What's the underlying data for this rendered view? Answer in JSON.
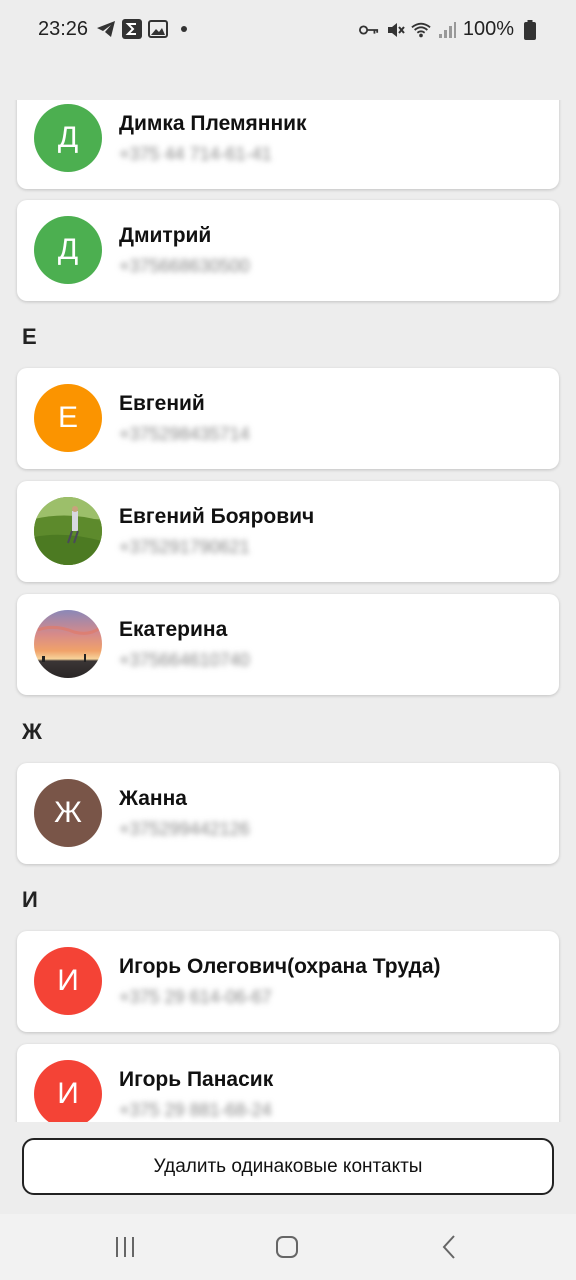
{
  "status_bar": {
    "time": "23:26",
    "left_icons": [
      "telegram-icon",
      "sigma-icon",
      "gallery-icon",
      "dot-icon"
    ],
    "right_icons": [
      "key-icon",
      "mute-icon",
      "wifi-icon",
      "signal-icon"
    ],
    "battery": "100%"
  },
  "contacts": [
    {
      "name": "Димка Племянник",
      "phone": "+375 44 714-61-41",
      "initial": "Д",
      "color": "#4caf50"
    },
    {
      "name": "Дмитрий",
      "phone": "+375668630500",
      "initial": "Д",
      "color": "#4caf50"
    },
    {
      "name": "Евгений",
      "phone": "+375298435714",
      "initial": "Е",
      "color": "#fb9400"
    },
    {
      "name": "Евгений Боярович",
      "phone": "+375291790621",
      "initial": "",
      "photo": "field-photo"
    },
    {
      "name": "Екатерина",
      "phone": "+375664610740",
      "initial": "",
      "photo": "sunset-photo"
    },
    {
      "name": "Жанна",
      "phone": "+375299442126",
      "initial": "Ж",
      "color": "#795548"
    },
    {
      "name": "Игорь Олегович(охрана Труда)",
      "phone": "+375 29 614-06-67",
      "initial": "И",
      "color": "#f44336"
    },
    {
      "name": "Игорь Панасик",
      "phone": "+375 29 881-68-24",
      "initial": "И",
      "color": "#f44336"
    }
  ],
  "sections": [
    "Е",
    "Ж",
    "И"
  ],
  "remove_duplicates_label": "Удалить одинаковые контакты",
  "nav": [
    "recents-icon",
    "home-icon",
    "back-icon"
  ]
}
